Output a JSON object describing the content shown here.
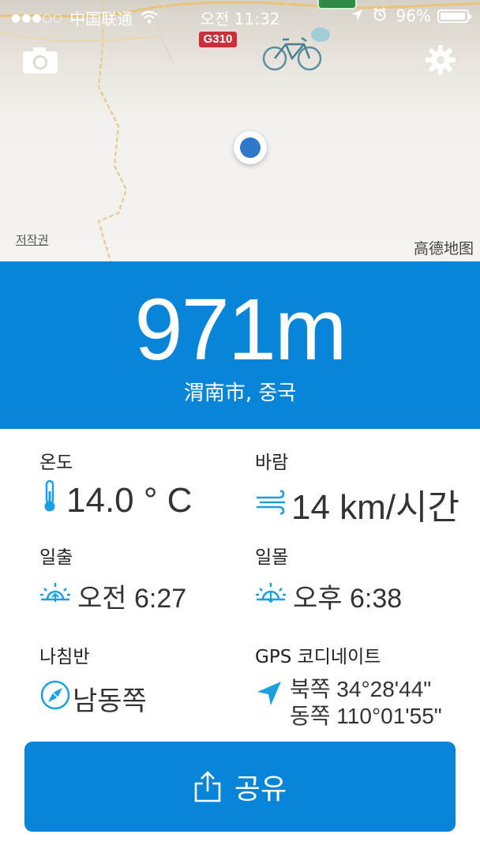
{
  "status_bar": {
    "signal": "●●●○○",
    "carrier": "中国联通",
    "time": "오전 11:32",
    "battery_percent": "96%",
    "battery_level": 0.96
  },
  "map": {
    "road_shield": "G310",
    "copyright_link": "저작권",
    "provider": "高德地图",
    "icons": {
      "camera": "camera-icon",
      "settings": "gear-icon",
      "location": "location-dot"
    }
  },
  "altitude": {
    "value": "971m",
    "place": "渭南市, 중국"
  },
  "weather": {
    "temperature": {
      "label": "온도",
      "value": "14.0 ° C",
      "icon": "thermometer-icon"
    },
    "wind": {
      "label": "바람",
      "value": "14 km/시간",
      "icon": "wind-icon"
    },
    "sunrise": {
      "label": "일출",
      "value": "오전 6:27",
      "icon": "sunrise-icon"
    },
    "sunset": {
      "label": "일몰",
      "value": "오후 6:38",
      "icon": "sunset-icon"
    },
    "compass": {
      "label": "나침반",
      "value": "남동쪽",
      "icon": "compass-icon"
    },
    "gps": {
      "label": "GPS 코디네이트",
      "lat": "북쪽 34°28'44\"",
      "lon": "동쪽 110°01'55\"",
      "icon": "navigation-arrow-icon"
    }
  },
  "share": {
    "label": "공유",
    "icon": "share-icon"
  },
  "colors": {
    "accent": "#0885d8",
    "icon_blue": "#1aa0e0",
    "dot_blue": "#2e79c9"
  }
}
